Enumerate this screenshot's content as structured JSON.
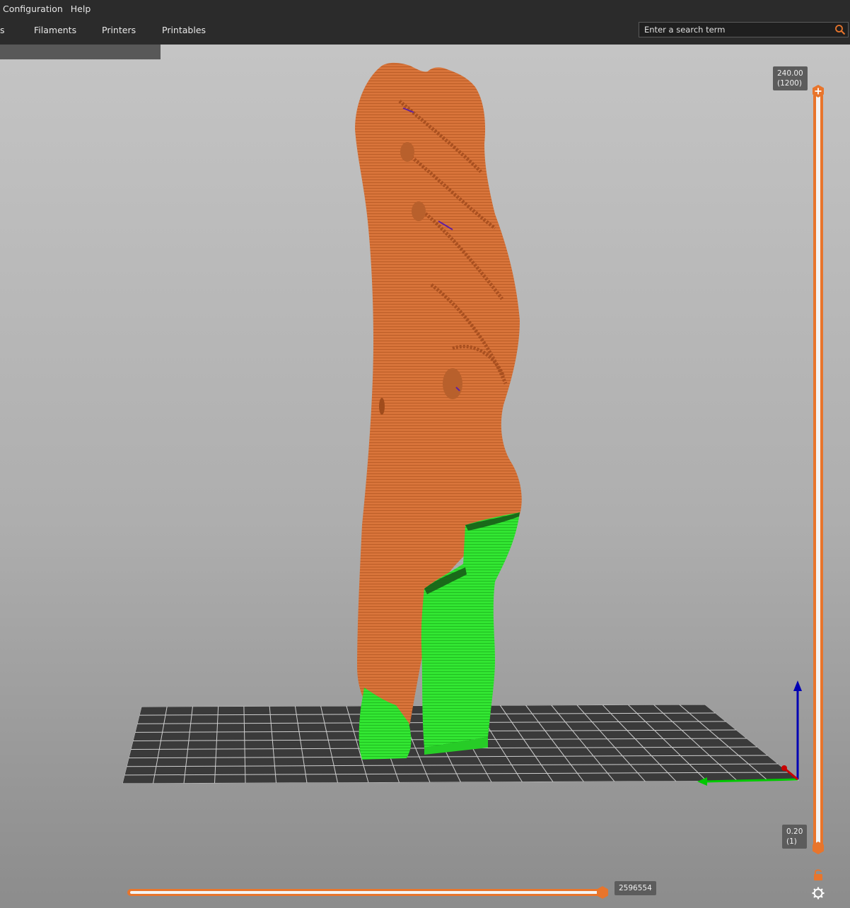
{
  "menu": {
    "items": [
      "Configuration",
      "Help"
    ]
  },
  "tabs": {
    "partial_first": "s",
    "items": [
      "Filaments",
      "Printers",
      "Printables"
    ]
  },
  "search": {
    "placeholder": "Enter a search term",
    "icon": "search-icon"
  },
  "vertical_slider": {
    "top_value": "240.00",
    "top_layer": "(1200)",
    "bottom_value": "0.20",
    "bottom_layer": "(1)",
    "top_icon": "plus-icon",
    "lock_icon": "lock-icon",
    "settings_icon": "cog-icon"
  },
  "horizontal_slider": {
    "value": "2596554"
  },
  "colors": {
    "accent": "#e8752c",
    "model": "#d8743a",
    "support": "#32e632",
    "bar": "#2b2b2b",
    "axis_z": "#0000b4",
    "axis_y": "#00c800",
    "axis_x": "#c80000"
  }
}
